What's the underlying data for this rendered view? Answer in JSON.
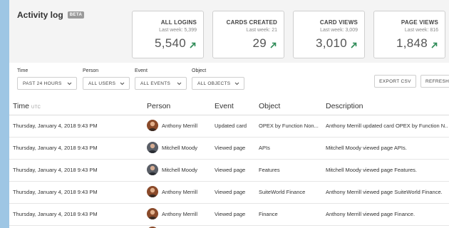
{
  "header": {
    "title": "Activity log",
    "badge": "BETA"
  },
  "stats": [
    {
      "label": "ALL LOGINS",
      "last_week": "Last week: 5,399",
      "value": "5,540"
    },
    {
      "label": "CARDS CREATED",
      "last_week": "Last week: 21",
      "value": "29"
    },
    {
      "label": "CARD VIEWS",
      "last_week": "Last week: 3,009",
      "value": "3,010"
    },
    {
      "label": "PAGE VIEWS",
      "last_week": "Last week: 816",
      "value": "1,848"
    }
  ],
  "filters": {
    "time": {
      "label": "Time",
      "value": "PAST 24 HOURS"
    },
    "person": {
      "label": "Person",
      "value": "ALL USERS"
    },
    "event": {
      "label": "Event",
      "value": "ALL EVENTS"
    },
    "object": {
      "label": "Object",
      "value": "ALL OBJECTS"
    }
  },
  "actions": {
    "export": "EXPORT CSV",
    "refresh": "REFRESH"
  },
  "table": {
    "columns": {
      "time": "Time",
      "time_sub": "UTC",
      "person": "Person",
      "event": "Event",
      "object": "Object",
      "description": "Description"
    },
    "rows": [
      {
        "time": "Thursday, January 4, 2018 9:43 PM",
        "person": "Anthony Merrill",
        "event": "Updated card",
        "object": "OPEX by Function Non...",
        "description": "Anthony Merrill updated card OPEX by Function N..."
      },
      {
        "time": "Thursday, January 4, 2018 9:43 PM",
        "person": "Mitchell Moody",
        "event": "Viewed page",
        "object": "APIs",
        "description": "Mitchell Moody viewed page APIs."
      },
      {
        "time": "Thursday, January 4, 2018 9:43 PM",
        "person": "Mitchell Moody",
        "event": "Viewed page",
        "object": "Features",
        "description": "Mitchell Moody viewed page Features."
      },
      {
        "time": "Thursday, January 4, 2018 9:43 PM",
        "person": "Anthony Merrill",
        "event": "Viewed page",
        "object": "SuiteWorld Finance",
        "description": "Anthony Merrill viewed page SuiteWorld Finance."
      },
      {
        "time": "Thursday, January 4, 2018 9:43 PM",
        "person": "Anthony Merrill",
        "event": "Viewed page",
        "object": "Finance",
        "description": "Anthony Merrill viewed page Finance."
      }
    ]
  },
  "colors": {
    "trend_up": "#2e8b57",
    "avatar_anthony": "#8a4a2a",
    "avatar_mitchell": "#5a5e66"
  }
}
